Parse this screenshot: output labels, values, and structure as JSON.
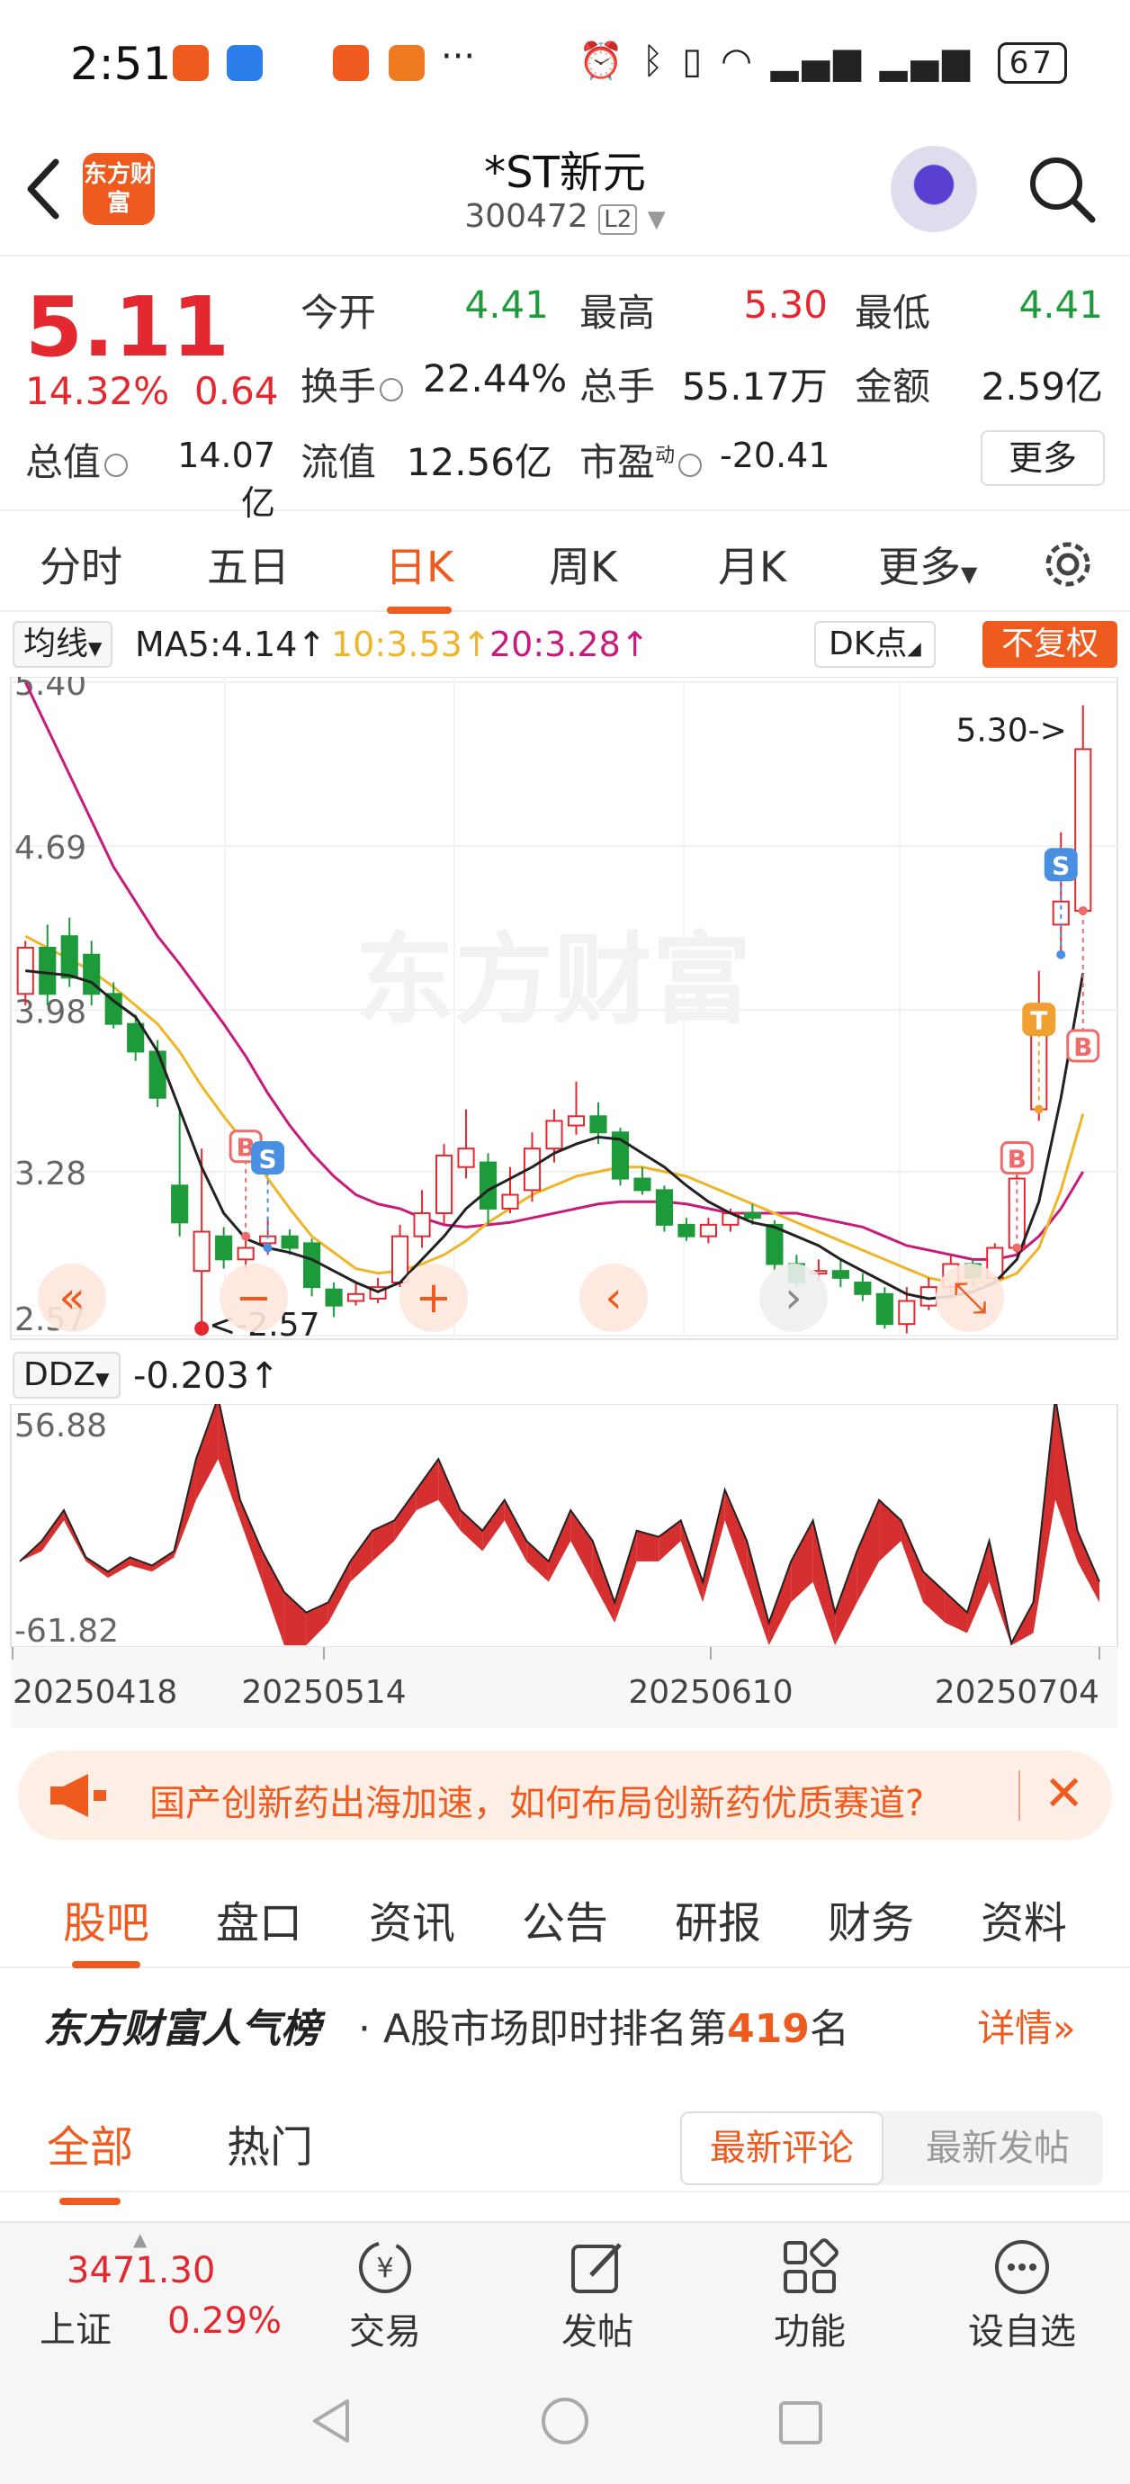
{
  "status_bar": {
    "time": "2:51",
    "battery": "67",
    "more": "···"
  },
  "header": {
    "title": "*ST新元",
    "code": "300472",
    "level_badge": "L2",
    "logo_text": "东方财富"
  },
  "quote": {
    "price": "5.11",
    "change_pct": "14.32%",
    "change": "0.64",
    "open_label": "今开",
    "open": "4.41",
    "high_label": "最高",
    "high": "5.30",
    "low_label": "最低",
    "low": "4.41",
    "turnover_label": "换手",
    "turnover": "22.44%",
    "volume_label": "总手",
    "volume": "55.17万",
    "amount_label": "金额",
    "amount": "2.59亿",
    "mktcap_label": "总值",
    "mktcap": "14.07亿",
    "float_label": "流值",
    "float": "12.56亿",
    "pe_label": "市盈",
    "pe_sup": "动",
    "pe": "-20.41",
    "more_label": "更多"
  },
  "period_tabs": [
    "分时",
    "五日",
    "日K",
    "周K",
    "月K",
    "更多"
  ],
  "active_period": "日K",
  "ma": {
    "select_label": "均线",
    "ma5": "MA5:4.14↑",
    "ma10": "10:3.53↑",
    "ma20": "20:3.28↑",
    "dk_label": "DK点",
    "adjust_label": "不复权"
  },
  "colors": {
    "accent": "#ef5a1f",
    "up": "#e3282f",
    "down": "#1d9a3a",
    "ma5": "#222222",
    "ma10": "#f0b429",
    "ma20": "#c81a7d"
  },
  "chart_data": {
    "type": "candlestick",
    "y_ticks": [
      "5.40",
      "4.69",
      "3.98",
      "3.28",
      "2.57"
    ],
    "ylim": [
      2.57,
      5.4
    ],
    "max_label": "5.30->",
    "min_label": "<-2.57",
    "watermark": "东方财富",
    "x_labels": [
      "20250418",
      "20250514",
      "20250610",
      "20250704"
    ],
    "candles": [
      {
        "o": 4.05,
        "c": 4.25,
        "h": 4.28,
        "l": 4.0
      },
      {
        "o": 4.25,
        "c": 4.05,
        "h": 4.35,
        "l": 4.0
      },
      {
        "o": 4.3,
        "c": 4.12,
        "h": 4.38,
        "l": 4.08
      },
      {
        "o": 4.22,
        "c": 4.05,
        "h": 4.28,
        "l": 4.0
      },
      {
        "o": 4.05,
        "c": 3.92,
        "h": 4.1,
        "l": 3.9
      },
      {
        "o": 3.92,
        "c": 3.8,
        "h": 3.96,
        "l": 3.76
      },
      {
        "o": 3.8,
        "c": 3.6,
        "h": 3.85,
        "l": 3.56
      },
      {
        "o": 3.22,
        "c": 3.06,
        "h": 3.55,
        "l": 3.0
      },
      {
        "o": 2.85,
        "c": 3.02,
        "h": 3.38,
        "l": 2.57
      },
      {
        "o": 3.0,
        "c": 2.9,
        "h": 3.04,
        "l": 2.86
      },
      {
        "o": 2.9,
        "c": 2.95,
        "h": 3.0,
        "l": 2.86
      },
      {
        "o": 2.97,
        "c": 3.0,
        "h": 3.08,
        "l": 2.92
      },
      {
        "o": 3.0,
        "c": 2.95,
        "h": 3.03,
        "l": 2.92
      },
      {
        "o": 2.97,
        "c": 2.78,
        "h": 2.99,
        "l": 2.74
      },
      {
        "o": 2.77,
        "c": 2.7,
        "h": 2.8,
        "l": 2.65
      },
      {
        "o": 2.72,
        "c": 2.75,
        "h": 2.8,
        "l": 2.7
      },
      {
        "o": 2.73,
        "c": 2.78,
        "h": 2.82,
        "l": 2.71
      },
      {
        "o": 2.8,
        "c": 3.0,
        "h": 3.05,
        "l": 2.78
      },
      {
        "o": 3.0,
        "c": 3.1,
        "h": 3.2,
        "l": 2.95
      },
      {
        "o": 3.1,
        "c": 3.35,
        "h": 3.4,
        "l": 3.05
      },
      {
        "o": 3.3,
        "c": 3.38,
        "h": 3.55,
        "l": 3.25
      },
      {
        "o": 3.32,
        "c": 3.12,
        "h": 3.36,
        "l": 3.05
      },
      {
        "o": 3.12,
        "c": 3.18,
        "h": 3.3,
        "l": 3.1
      },
      {
        "o": 3.2,
        "c": 3.38,
        "h": 3.45,
        "l": 3.15
      },
      {
        "o": 3.38,
        "c": 3.5,
        "h": 3.55,
        "l": 3.32
      },
      {
        "o": 3.48,
        "c": 3.52,
        "h": 3.67,
        "l": 3.44
      },
      {
        "o": 3.52,
        "c": 3.45,
        "h": 3.58,
        "l": 3.4
      },
      {
        "o": 3.45,
        "c": 3.25,
        "h": 3.47,
        "l": 3.22
      },
      {
        "o": 3.25,
        "c": 3.2,
        "h": 3.3,
        "l": 3.18
      },
      {
        "o": 3.2,
        "c": 3.05,
        "h": 3.22,
        "l": 3.02
      },
      {
        "o": 3.05,
        "c": 3.0,
        "h": 3.08,
        "l": 2.98
      },
      {
        "o": 3.0,
        "c": 3.05,
        "h": 3.08,
        "l": 2.97
      },
      {
        "o": 3.05,
        "c": 3.1,
        "h": 3.12,
        "l": 3.02
      },
      {
        "o": 3.1,
        "c": 3.08,
        "h": 3.14,
        "l": 3.05
      },
      {
        "o": 3.05,
        "c": 2.88,
        "h": 3.07,
        "l": 2.85
      },
      {
        "o": 2.88,
        "c": 2.8,
        "h": 2.92,
        "l": 2.78
      },
      {
        "o": 2.85,
        "c": 2.85,
        "h": 2.9,
        "l": 2.8
      },
      {
        "o": 2.85,
        "c": 2.82,
        "h": 2.9,
        "l": 2.78
      },
      {
        "o": 2.8,
        "c": 2.75,
        "h": 2.84,
        "l": 2.72
      },
      {
        "o": 2.75,
        "c": 2.62,
        "h": 2.78,
        "l": 2.6
      },
      {
        "o": 2.62,
        "c": 2.72,
        "h": 2.78,
        "l": 2.58
      },
      {
        "o": 2.7,
        "c": 2.78,
        "h": 2.82,
        "l": 2.68
      },
      {
        "o": 2.78,
        "c": 2.88,
        "h": 2.92,
        "l": 2.76
      },
      {
        "o": 2.88,
        "c": 2.82,
        "h": 2.9,
        "l": 2.78
      },
      {
        "o": 2.82,
        "c": 2.95,
        "h": 2.97,
        "l": 2.8
      },
      {
        "o": 2.95,
        "c": 3.25,
        "h": 3.3,
        "l": 2.92
      },
      {
        "o": 3.55,
        "c": 3.9,
        "h": 4.15,
        "l": 3.5
      },
      {
        "o": 4.35,
        "c": 4.45,
        "h": 4.75,
        "l": 4.22
      },
      {
        "o": 4.41,
        "c": 5.11,
        "h": 5.3,
        "l": 4.41
      }
    ],
    "ma5": [
      4.15,
      4.14,
      4.13,
      4.1,
      4.02,
      3.95,
      3.8,
      3.55,
      3.3,
      3.1,
      2.99,
      2.95,
      2.93,
      2.9,
      2.85,
      2.8,
      2.76,
      2.8,
      2.9,
      3.0,
      3.12,
      3.2,
      3.25,
      3.3,
      3.36,
      3.4,
      3.43,
      3.42,
      3.36,
      3.3,
      3.22,
      3.15,
      3.1,
      3.06,
      3.04,
      3.0,
      2.96,
      2.9,
      2.85,
      2.8,
      2.75,
      2.73,
      2.74,
      2.76,
      2.8,
      2.9,
      3.15,
      3.6,
      4.14
    ],
    "ma10": [
      4.3,
      4.25,
      4.2,
      4.15,
      4.08,
      4.0,
      3.92,
      3.8,
      3.65,
      3.52,
      3.4,
      3.25,
      3.12,
      3.0,
      2.93,
      2.86,
      2.84,
      2.85,
      2.88,
      2.92,
      2.98,
      3.06,
      3.12,
      3.18,
      3.22,
      3.26,
      3.28,
      3.3,
      3.3,
      3.28,
      3.26,
      3.22,
      3.18,
      3.14,
      3.1,
      3.06,
      3.02,
      2.98,
      2.94,
      2.9,
      2.86,
      2.82,
      2.8,
      2.8,
      2.8,
      2.84,
      2.95,
      3.2,
      3.53
    ],
    "ma20": [
      5.4,
      5.2,
      5.0,
      4.8,
      4.6,
      4.45,
      4.3,
      4.18,
      4.05,
      3.92,
      3.78,
      3.62,
      3.48,
      3.36,
      3.26,
      3.18,
      3.14,
      3.12,
      3.08,
      3.05,
      3.04,
      3.05,
      3.06,
      3.08,
      3.1,
      3.12,
      3.14,
      3.15,
      3.15,
      3.15,
      3.14,
      3.12,
      3.1,
      3.1,
      3.1,
      3.1,
      3.08,
      3.06,
      3.04,
      3.0,
      2.96,
      2.94,
      2.92,
      2.9,
      2.9,
      2.92,
      3.0,
      3.12,
      3.28
    ],
    "signals": [
      {
        "label": "B",
        "index": 10,
        "price": 3.0
      },
      {
        "label": "S",
        "index": 11,
        "price": 2.95
      },
      {
        "label": "B",
        "index": 45,
        "price": 2.95
      },
      {
        "label": "T",
        "index": 46,
        "price": 3.55
      },
      {
        "label": "S",
        "index": 47,
        "price": 4.22
      },
      {
        "label": "B",
        "index": 48,
        "price": 4.41
      }
    ],
    "ddz": {
      "label": "DDZ",
      "value": "-0.203↑",
      "ylim": [
        -61.82,
        56.88
      ],
      "y_ticks": [
        "56.88",
        "-61.82"
      ],
      "line_a": [
        -20,
        -10,
        5,
        -18,
        -25,
        -18,
        -22,
        -15,
        30,
        60,
        10,
        -15,
        -35,
        -45,
        -40,
        -20,
        -5,
        0,
        15,
        30,
        5,
        -5,
        10,
        -10,
        -20,
        5,
        -10,
        -40,
        -5,
        -8,
        0,
        -30,
        15,
        -10,
        -50,
        -20,
        0,
        -45,
        -15,
        10,
        0,
        -25,
        -35,
        -45,
        -10,
        -60,
        -40,
        60,
        -5,
        -30
      ],
      "line_b": [
        -20,
        -15,
        0,
        -20,
        -28,
        -22,
        -25,
        -18,
        10,
        30,
        0,
        -30,
        -61,
        -61,
        -50,
        -30,
        -20,
        -10,
        5,
        10,
        -5,
        -15,
        0,
        -20,
        -30,
        -10,
        -30,
        -50,
        -20,
        -20,
        -10,
        -40,
        0,
        -30,
        -61,
        -40,
        -30,
        -61,
        -40,
        -20,
        -10,
        -40,
        -50,
        -55,
        -30,
        -61,
        -55,
        10,
        -20,
        -40
      ]
    }
  },
  "chart_controls": [
    "rewind",
    "zoom-out",
    "zoom-in",
    "prev",
    "next",
    "fullscreen"
  ],
  "banner": {
    "text": "国产创新药出海加速，如何布局创新药优质赛道?"
  },
  "sub_tabs": [
    "股吧",
    "盘口",
    "资讯",
    "公告",
    "研报",
    "财务",
    "资料"
  ],
  "active_sub_tab": "股吧",
  "ranking": {
    "brand": "东方财富人气榜",
    "prefix": "· A股市场即时排名第",
    "rank": "419",
    "suffix": "名",
    "more": "详情"
  },
  "filters": {
    "tabs": [
      "全部",
      "热门"
    ],
    "active": "全部",
    "sort_a": "最新评论",
    "sort_b": "最新发帖"
  },
  "bottom_bar": {
    "index_value": "3471.30",
    "index_name": "上证",
    "index_pct": "0.29%",
    "items": [
      "交易",
      "发帖",
      "功能",
      "设自选"
    ]
  }
}
